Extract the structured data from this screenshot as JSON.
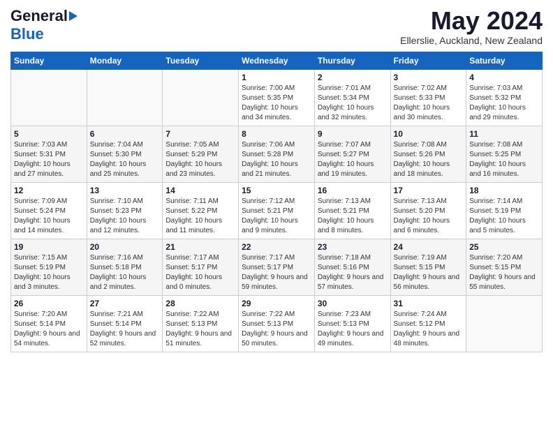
{
  "header": {
    "logo_general": "General",
    "logo_blue": "Blue",
    "title": "May 2024",
    "location": "Ellerslie, Auckland, New Zealand"
  },
  "calendar": {
    "days_of_week": [
      "Sunday",
      "Monday",
      "Tuesday",
      "Wednesday",
      "Thursday",
      "Friday",
      "Saturday"
    ],
    "weeks": [
      [
        {
          "day": "",
          "info": ""
        },
        {
          "day": "",
          "info": ""
        },
        {
          "day": "",
          "info": ""
        },
        {
          "day": "1",
          "sunrise": "7:00 AM",
          "sunset": "5:35 PM",
          "daylight": "10 hours and 34 minutes."
        },
        {
          "day": "2",
          "sunrise": "7:01 AM",
          "sunset": "5:34 PM",
          "daylight": "10 hours and 32 minutes."
        },
        {
          "day": "3",
          "sunrise": "7:02 AM",
          "sunset": "5:33 PM",
          "daylight": "10 hours and 30 minutes."
        },
        {
          "day": "4",
          "sunrise": "7:03 AM",
          "sunset": "5:32 PM",
          "daylight": "10 hours and 29 minutes."
        }
      ],
      [
        {
          "day": "5",
          "sunrise": "7:03 AM",
          "sunset": "5:31 PM",
          "daylight": "10 hours and 27 minutes."
        },
        {
          "day": "6",
          "sunrise": "7:04 AM",
          "sunset": "5:30 PM",
          "daylight": "10 hours and 25 minutes."
        },
        {
          "day": "7",
          "sunrise": "7:05 AM",
          "sunset": "5:29 PM",
          "daylight": "10 hours and 23 minutes."
        },
        {
          "day": "8",
          "sunrise": "7:06 AM",
          "sunset": "5:28 PM",
          "daylight": "10 hours and 21 minutes."
        },
        {
          "day": "9",
          "sunrise": "7:07 AM",
          "sunset": "5:27 PM",
          "daylight": "10 hours and 19 minutes."
        },
        {
          "day": "10",
          "sunrise": "7:08 AM",
          "sunset": "5:26 PM",
          "daylight": "10 hours and 18 minutes."
        },
        {
          "day": "11",
          "sunrise": "7:08 AM",
          "sunset": "5:25 PM",
          "daylight": "10 hours and 16 minutes."
        }
      ],
      [
        {
          "day": "12",
          "sunrise": "7:09 AM",
          "sunset": "5:24 PM",
          "daylight": "10 hours and 14 minutes."
        },
        {
          "day": "13",
          "sunrise": "7:10 AM",
          "sunset": "5:23 PM",
          "daylight": "10 hours and 12 minutes."
        },
        {
          "day": "14",
          "sunrise": "7:11 AM",
          "sunset": "5:22 PM",
          "daylight": "10 hours and 11 minutes."
        },
        {
          "day": "15",
          "sunrise": "7:12 AM",
          "sunset": "5:21 PM",
          "daylight": "10 hours and 9 minutes."
        },
        {
          "day": "16",
          "sunrise": "7:13 AM",
          "sunset": "5:21 PM",
          "daylight": "10 hours and 8 minutes."
        },
        {
          "day": "17",
          "sunrise": "7:13 AM",
          "sunset": "5:20 PM",
          "daylight": "10 hours and 6 minutes."
        },
        {
          "day": "18",
          "sunrise": "7:14 AM",
          "sunset": "5:19 PM",
          "daylight": "10 hours and 5 minutes."
        }
      ],
      [
        {
          "day": "19",
          "sunrise": "7:15 AM",
          "sunset": "5:19 PM",
          "daylight": "10 hours and 3 minutes."
        },
        {
          "day": "20",
          "sunrise": "7:16 AM",
          "sunset": "5:18 PM",
          "daylight": "10 hours and 2 minutes."
        },
        {
          "day": "21",
          "sunrise": "7:17 AM",
          "sunset": "5:17 PM",
          "daylight": "10 hours and 0 minutes."
        },
        {
          "day": "22",
          "sunrise": "7:17 AM",
          "sunset": "5:17 PM",
          "daylight": "9 hours and 59 minutes."
        },
        {
          "day": "23",
          "sunrise": "7:18 AM",
          "sunset": "5:16 PM",
          "daylight": "9 hours and 57 minutes."
        },
        {
          "day": "24",
          "sunrise": "7:19 AM",
          "sunset": "5:15 PM",
          "daylight": "9 hours and 56 minutes."
        },
        {
          "day": "25",
          "sunrise": "7:20 AM",
          "sunset": "5:15 PM",
          "daylight": "9 hours and 55 minutes."
        }
      ],
      [
        {
          "day": "26",
          "sunrise": "7:20 AM",
          "sunset": "5:14 PM",
          "daylight": "9 hours and 54 minutes."
        },
        {
          "day": "27",
          "sunrise": "7:21 AM",
          "sunset": "5:14 PM",
          "daylight": "9 hours and 52 minutes."
        },
        {
          "day": "28",
          "sunrise": "7:22 AM",
          "sunset": "5:13 PM",
          "daylight": "9 hours and 51 minutes."
        },
        {
          "day": "29",
          "sunrise": "7:22 AM",
          "sunset": "5:13 PM",
          "daylight": "9 hours and 50 minutes."
        },
        {
          "day": "30",
          "sunrise": "7:23 AM",
          "sunset": "5:13 PM",
          "daylight": "9 hours and 49 minutes."
        },
        {
          "day": "31",
          "sunrise": "7:24 AM",
          "sunset": "5:12 PM",
          "daylight": "9 hours and 48 minutes."
        },
        {
          "day": "",
          "info": ""
        }
      ]
    ]
  }
}
